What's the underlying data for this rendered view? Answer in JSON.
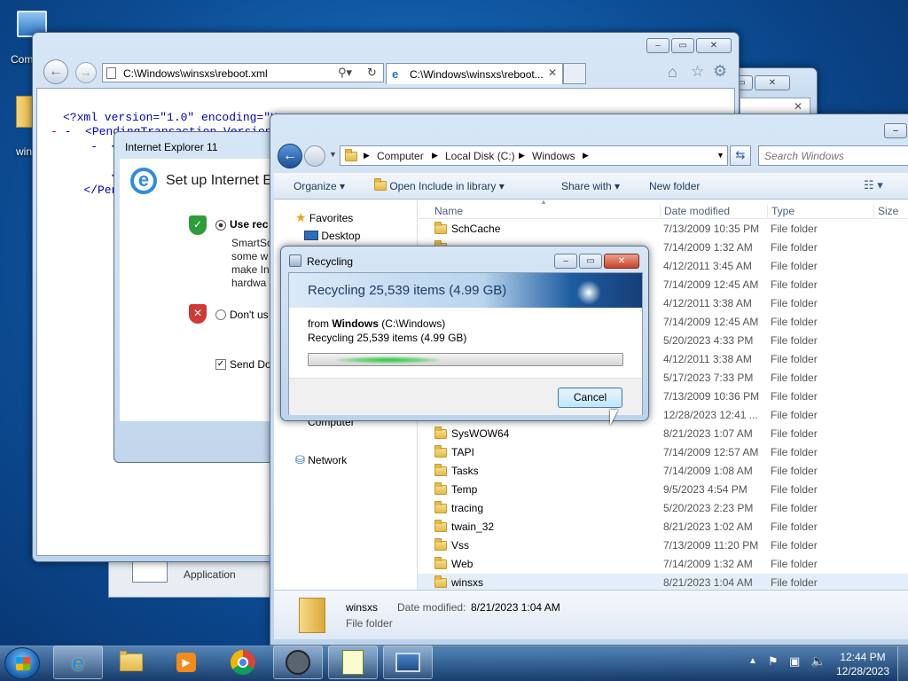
{
  "desktop": {
    "icon1_label": "Com",
    "icon2_label": "win"
  },
  "ie": {
    "address": "C:\\Windows\\winsxs\\reboot.xml",
    "tab_label": "C:\\Windows\\winsxs\\reboot...",
    "xml_lines": [
      "<?xml version=\"1.0\" encoding=\"U",
      "-  <PendingTransaction Version=\"3.1",
      "    -  <POQ",
      "             <",
      "       </PO",
      "   </Pendin"
    ]
  },
  "ie_setup": {
    "title": "Internet Explorer 11",
    "heading": "Set up Internet E",
    "use_label": "Use rec",
    "desc_lines": [
      "SmartSc",
      "some w",
      "make In",
      "hardwa"
    ],
    "dont_label": "Don't us",
    "send_label": "Send Do"
  },
  "app_label": "Application",
  "explorer": {
    "breadcrumb": [
      "Computer",
      "Local Disk (C:)",
      "Windows"
    ],
    "search_placeholder": "Search Windows",
    "toolbar": {
      "organize": "Organize",
      "open": "Open",
      "include": "Include in library",
      "share": "Share with",
      "newfolder": "New folder"
    },
    "nav": {
      "favorites": "Favorites",
      "desktop": "Desktop",
      "computer": "Computer",
      "network": "Network"
    },
    "columns": {
      "name": "Name",
      "date": "Date modified",
      "type": "Type",
      "size": "Size"
    },
    "rows": [
      {
        "name": "SchCache",
        "date": "7/13/2009 10:35 PM",
        "type": "File folder"
      },
      {
        "name": "",
        "date": "7/14/2009 1:32 AM",
        "type": "File folder"
      },
      {
        "name": "",
        "date": "4/12/2011 3:45 AM",
        "type": "File folder"
      },
      {
        "name": "",
        "date": "7/14/2009 12:45 AM",
        "type": "File folder"
      },
      {
        "name": "",
        "date": "4/12/2011 3:38 AM",
        "type": "File folder"
      },
      {
        "name": "",
        "date": "7/14/2009 12:45 AM",
        "type": "File folder"
      },
      {
        "name": "",
        "date": "5/20/2023 4:33 PM",
        "type": "File folder"
      },
      {
        "name": "",
        "date": "4/12/2011 3:38 AM",
        "type": "File folder"
      },
      {
        "name": "",
        "date": "5/17/2023 7:33 PM",
        "type": "File folder"
      },
      {
        "name": "",
        "date": "7/13/2009 10:36 PM",
        "type": "File folder"
      },
      {
        "name": "",
        "date": "12/28/2023 12:41 ...",
        "type": "File folder"
      },
      {
        "name": "SysWOW64",
        "date": "8/21/2023 1:07 AM",
        "type": "File folder"
      },
      {
        "name": "TAPI",
        "date": "7/14/2009 12:57 AM",
        "type": "File folder"
      },
      {
        "name": "Tasks",
        "date": "7/14/2009 1:08 AM",
        "type": "File folder"
      },
      {
        "name": "Temp",
        "date": "9/5/2023 4:54 PM",
        "type": "File folder"
      },
      {
        "name": "tracing",
        "date": "5/20/2023 2:23 PM",
        "type": "File folder"
      },
      {
        "name": "twain_32",
        "date": "8/21/2023 1:02 AM",
        "type": "File folder"
      },
      {
        "name": "Vss",
        "date": "7/13/2009 11:20 PM",
        "type": "File folder"
      },
      {
        "name": "Web",
        "date": "7/14/2009 1:32 AM",
        "type": "File folder"
      },
      {
        "name": "winsxs",
        "date": "8/21/2023 1:04 AM",
        "type": "File folder"
      }
    ],
    "details": {
      "name": "winsxs",
      "date_label": "Date modified:",
      "date_value": "8/21/2023 1:04 AM",
      "type": "File folder"
    }
  },
  "recycle": {
    "title": "Recycling",
    "banner": "Recycling 25,539 items (4.99 GB)",
    "from_prefix": "from ",
    "from_name": "Windows",
    "from_path": " (C:\\Windows)",
    "status": "Recycling 25,539 items (4.99 GB)",
    "cancel": "Cancel"
  },
  "taskbar": {
    "time": "12:44 PM",
    "date": "12/28/2023"
  },
  "colors": {
    "accent": "#1f5fa8",
    "progress": "#27c93f"
  }
}
